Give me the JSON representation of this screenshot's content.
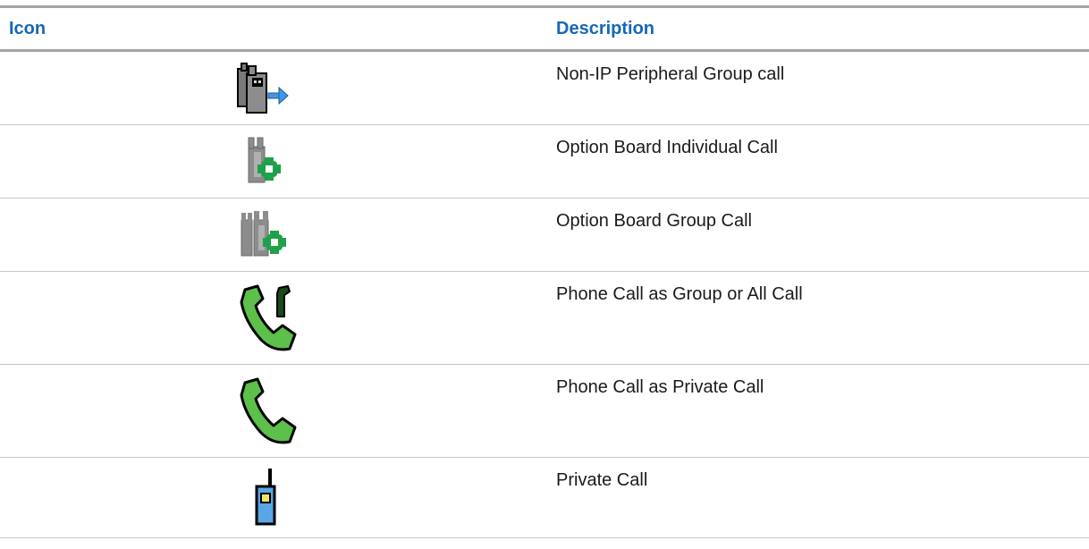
{
  "table": {
    "headers": {
      "icon": "Icon",
      "description": "Description"
    },
    "rows": [
      {
        "icon": "non-ip-peripheral-group-call-icon",
        "description": "Non-IP Peripheral Group call"
      },
      {
        "icon": "option-board-individual-call-icon",
        "description": "Option Board Individual Call"
      },
      {
        "icon": "option-board-group-call-icon",
        "description": "Option Board Group Call"
      },
      {
        "icon": "phone-call-group-all-call-icon",
        "description": "Phone Call as Group or All Call"
      },
      {
        "icon": "phone-call-private-call-icon",
        "description": "Phone Call as Private Call"
      },
      {
        "icon": "private-call-icon",
        "description": "Private Call"
      }
    ]
  },
  "colors": {
    "header_text": "#1567b7",
    "rule": "#a3a3a3",
    "row_divider": "#c8c8c8",
    "phone_green": "#5cc04a",
    "option_green": "#1ea14a",
    "radio_blue": "#5aa5e6",
    "arrow_blue": "#3f97e6"
  }
}
